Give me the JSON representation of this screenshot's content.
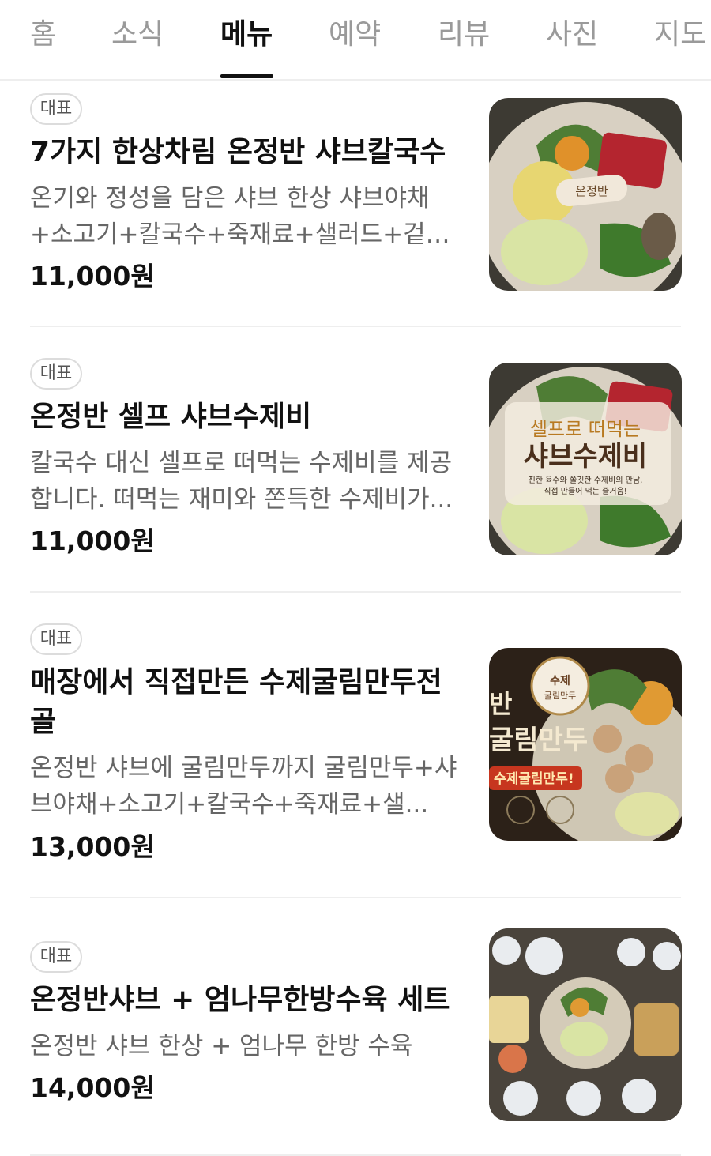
{
  "tabs": [
    {
      "label": "홈"
    },
    {
      "label": "소식"
    },
    {
      "label": "메뉴",
      "active": true
    },
    {
      "label": "예약"
    },
    {
      "label": "리뷰"
    },
    {
      "label": "사진"
    },
    {
      "label": "지도"
    }
  ],
  "menu": [
    {
      "badge": "대표",
      "name": "7가지 한상차림 온정반 샤브칼국수",
      "description": "온기와 정성을 담은 샤브 한상 샤브야채+소고기+칼국수+죽재료+샐러드+겉절...",
      "price": "11,000원",
      "image_text": "온정반"
    },
    {
      "badge": "대표",
      "name": "온정반 셀프 샤브수제비",
      "description": "칼국수 대신 셀프로 떠먹는 수제비를 제공합니다. 떠먹는 재미와 쫀득한 수제비가...",
      "price": "11,000원",
      "image_text_line1": "셀프로 떠먹는",
      "image_text_line2": "샤브수제비",
      "image_text_line3": "진한 육수와 쫄깃한 수제비의 만남,",
      "image_text_line4": "직접 만들어 먹는 즐거움!"
    },
    {
      "badge": "대표",
      "name": "매장에서 직접만든 수제굴림만두전골",
      "description": "온정반 샤브에 굴림만두까지 굴림만두+샤브야채+소고기+칼국수+죽재료+샐...",
      "price": "13,000원",
      "image_text_line1": "반",
      "image_text_line2": "굴림만두",
      "image_text_line3": "수제굴림만두!",
      "image_seal_line1": "수제",
      "image_seal_line2": "굴림만두"
    },
    {
      "badge": "대표",
      "name": "온정반샤브 + 엄나무한방수육 세트",
      "description": "온정반 샤브 한상 + 엄나무 한방 수육",
      "price": "14,000원"
    }
  ]
}
